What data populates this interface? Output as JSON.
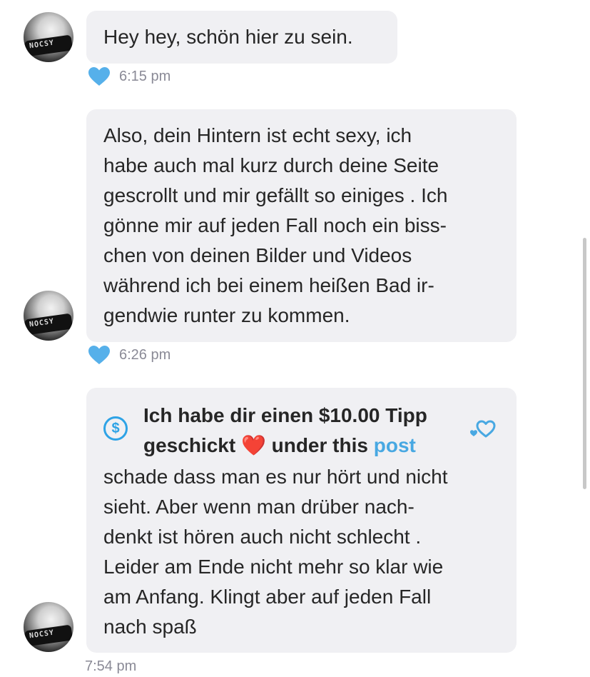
{
  "messages": [
    {
      "text": "Hey hey, schön hier zu sein.",
      "time": "6:15 pm",
      "reaction_icon": "heart-icon",
      "reaction_color": "#56b0ea"
    },
    {
      "text": "Also, dein Hintern ist echt sexy, ich\nhabe auch mal kurz durch deine Seite\ngescrollt und mir gefällt so einiges . Ich\ngönne mir auf jeden Fall noch ein biss-\nchen von deinen Bilder und Videos\nwährend ich bei einem heißen Bad ir-\ngendwie runter zu kommen.",
      "time": "6:26 pm",
      "reaction_icon": "heart-icon",
      "reaction_color": "#56b0ea"
    },
    {
      "tip": {
        "icon": "dollar-circle-icon",
        "line1": "Ich habe dir einen $10.00 Tipp",
        "line2_start": "geschickt",
        "emoji": "❤️",
        "line2_mid": "under this",
        "link": "post"
      },
      "text": "schade dass man es nur hört und nicht\nsieht. Aber wenn man drüber nach-\ndenkt ist hören auch nicht schlecht .\nLeider am Ende nicht mehr so klar wie\nam Anfang. Klingt aber auf jeden Fall\nnach spaß",
      "time": "7:54 pm",
      "like_icon": "heart-outline-icon"
    }
  ],
  "avatar": {
    "badge_text": "NOCSY"
  },
  "colors": {
    "accent": "#48a8e2",
    "bubble": "#f0f0f3",
    "timestamp": "#8a8a96"
  }
}
